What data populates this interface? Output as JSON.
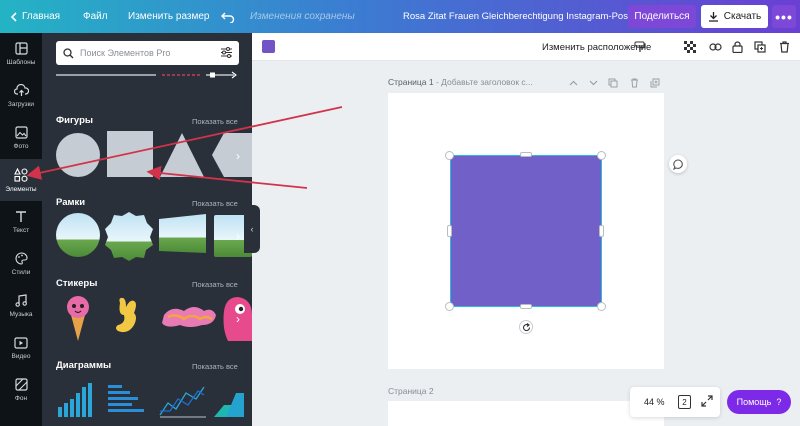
{
  "topbar": {
    "home": "Главная",
    "file": "Файл",
    "resize": "Изменить размер",
    "saved_status": "Изменения сохранены",
    "document_title": "Rosa Zitat Frauen Gleichberechtigung Instagram-Post",
    "share": "Поделиться",
    "download": "Скачать",
    "more": "•••"
  },
  "rail": {
    "items": [
      {
        "label": "Шаблоны",
        "icon": "templates-icon"
      },
      {
        "label": "Загрузки",
        "icon": "upload-cloud-icon"
      },
      {
        "label": "Фото",
        "icon": "photo-icon"
      },
      {
        "label": "Элементы",
        "icon": "elements-icon"
      },
      {
        "label": "Текст",
        "icon": "text-icon"
      },
      {
        "label": "Стили",
        "icon": "palette-icon"
      },
      {
        "label": "Музыка",
        "icon": "music-icon"
      },
      {
        "label": "Видео",
        "icon": "video-icon"
      },
      {
        "label": "Фон",
        "icon": "background-icon"
      }
    ],
    "active_index": 3
  },
  "panel": {
    "search_placeholder": "Поиск Элементов Pro",
    "sections": [
      {
        "title": "Фигуры",
        "show_all": "Показать все"
      },
      {
        "title": "Рамки",
        "show_all": "Показать все"
      },
      {
        "title": "Стикеры",
        "show_all": "Показать все"
      },
      {
        "title": "Диаграммы",
        "show_all": "Показать все"
      }
    ]
  },
  "editor_toolbar": {
    "color": "#7354c6",
    "arrange": "Изменить расположение",
    "icons": [
      "paint-roller-icon",
      "transparency-icon",
      "link-icon",
      "lock-icon",
      "duplicate-icon",
      "delete-icon"
    ]
  },
  "canvas": {
    "page1_label": "Страница 1",
    "page1_title_placeholder": " - Добавьте заголовок с...",
    "page2_label": "Страница 2",
    "shape_color": "#7060c7"
  },
  "zoom": {
    "level": "44 %",
    "page_count": "2"
  },
  "help": {
    "label": "Помощь",
    "mark": "?"
  },
  "colors": {
    "accent": "#7d2ae8",
    "selection": "#2bbce0",
    "arrow": "#d2334a"
  }
}
